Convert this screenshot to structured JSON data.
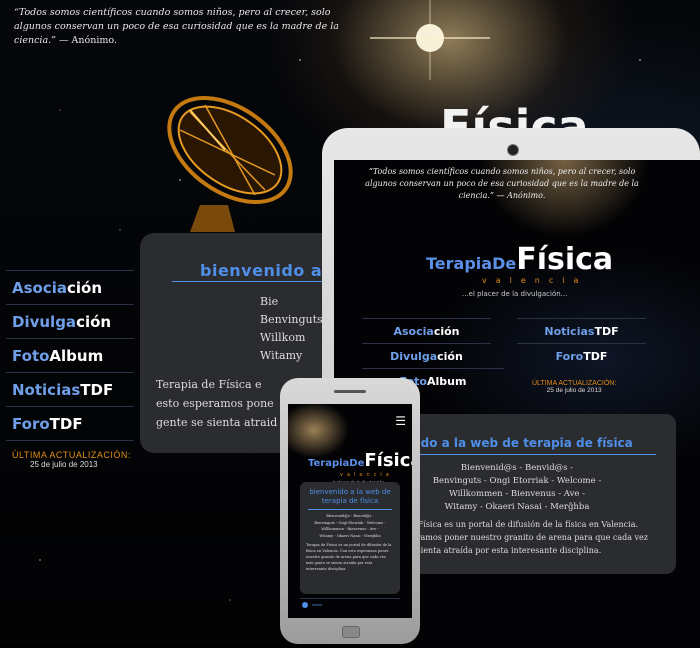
{
  "quote": {
    "text": "“Todos somos científicos cuando somos niños, pero al crecer, solo algunos conservan un poco de esa curiosidad que es la madre de la ciencia.”",
    "author": "— Anónimo."
  },
  "hero_title": "Física",
  "nav": [
    {
      "blue": "Asocia",
      "white": "ción"
    },
    {
      "blue": "Divulga",
      "white": "ción"
    },
    {
      "blue": "Foto",
      "white": "Album"
    },
    {
      "blue": "Noticias",
      "white": "TDF"
    },
    {
      "blue": "Foro",
      "white": "TDF"
    }
  ],
  "update": {
    "label": "ÚLTIMA ACTUALIZACIÓN:",
    "date": "25 de julio de 2013"
  },
  "panel": {
    "title": "bienvenido a",
    "greet": [
      "Bie",
      "Benvinguts",
      "Willkom",
      "Witamy"
    ],
    "desc": [
      "Terapia de Física e",
      "esto esperamos pone",
      "gente se sienta atraid"
    ]
  },
  "tablet": {
    "quote": "“Todos somos científicos cuando somos niños, pero al crecer, solo algunos conservan un poco de esa curiosidad que es la madre de la ciencia.” — Anónimo.",
    "logo": {
      "a": "TerapiaDe",
      "b": "Física",
      "c": "valencia",
      "d": "...el placer de la divulgación..."
    },
    "nav": [
      {
        "blue": "Asocia",
        "white": "ción"
      },
      {
        "blue": "Noticias",
        "white": "TDF"
      },
      {
        "blue": "Divulga",
        "white": "ción"
      },
      {
        "blue": "Foro",
        "white": "TDF"
      },
      {
        "blue": "Foto",
        "white": "Album"
      }
    ],
    "update": {
      "label": "ÚLTIMA ACTUALIZACIÓN:",
      "date": "25 de julio de 2013"
    },
    "panel": {
      "title": "venido a la web de terapia de física",
      "greet": [
        "Bienvenid@s - Benvid@s -",
        "Benvinguts - Ongi Etorriak - Welcome -",
        "Willkommen - Bienvenus - Ave -",
        "Witamy - Okaeri Nasai - Merĝhba"
      ],
      "desc": [
        "a de Física es un portal de difusión de la física en Valencia.",
        "esperamos poner nuestro granito de arena para que cada vez",
        "e se sienta atraída por esta interesante disciplina."
      ]
    }
  },
  "phone": {
    "menu_icon": "hamburger-menu-icon",
    "logo": {
      "a": "TerapiaDe",
      "b": "Física",
      "c": "valencia",
      "d": "...el placer de la divulgación..."
    },
    "panel": {
      "title": "bienvenido a la web de terapia de física",
      "greet": [
        "Bienvenid@s - Benvid@s -",
        "Benvinguts - Ongi Etorriak - Welcome -",
        "Willkommen - Bienvenus - Ave -",
        "Witamy - Okaeri Nasai - Merĝhba"
      ],
      "desc": "Terapia de Física es un portal de difusión de la física en Valencia. Con esto esperamos poner nuestro granito de arena para que cada vez más gente se sienta atraída por esta interesante disciplina."
    },
    "footer": "www"
  },
  "colors": {
    "accent_blue": "#4f8fe8",
    "accent_orange": "#e38b18",
    "panel": "#2b2c30"
  }
}
